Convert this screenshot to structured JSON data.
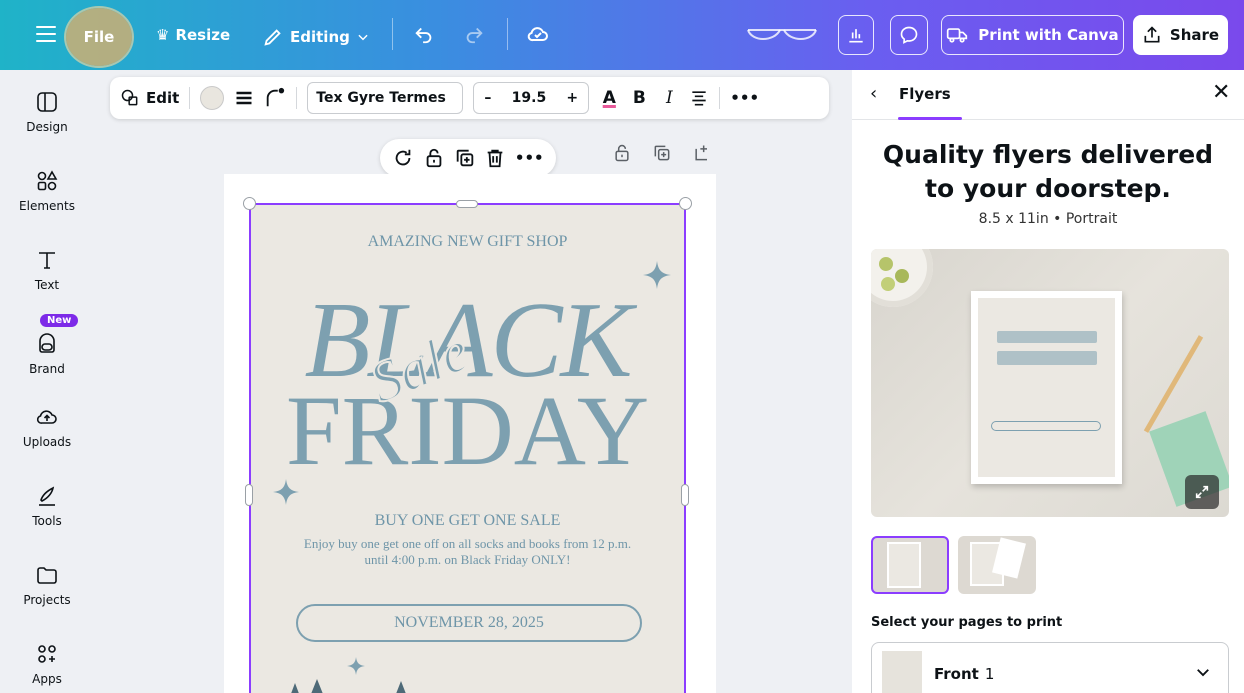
{
  "topbar": {
    "file_label": "File",
    "resize_label": "Resize",
    "editing_label": "Editing",
    "print_label": "Print with Canva",
    "share_label": "Share"
  },
  "sidebar": {
    "items": [
      {
        "label": "Design",
        "icon": "design-icon"
      },
      {
        "label": "Elements",
        "icon": "elements-icon"
      },
      {
        "label": "Text",
        "icon": "text-icon"
      },
      {
        "label": "Brand",
        "icon": "brand-icon"
      },
      {
        "label": "Uploads",
        "icon": "uploads-icon"
      },
      {
        "label": "Tools",
        "icon": "tools-icon"
      },
      {
        "label": "Projects",
        "icon": "projects-icon"
      },
      {
        "label": "Apps",
        "icon": "apps-icon"
      }
    ],
    "new_badge": "New"
  },
  "text_toolbar": {
    "edit_label": "Edit",
    "font": "Tex Gyre Termes",
    "size": "19.5",
    "minus": "–",
    "plus": "+",
    "color_glyph": "A",
    "bold_glyph": "B",
    "italic_glyph": "I",
    "more": "•••"
  },
  "elem_toolbar": {
    "more": "•••"
  },
  "flyer": {
    "shop": "AMAZING NEW GIFT SHOP",
    "black": "BLACK",
    "sale": "Sale",
    "friday": "FRIDAY",
    "bogo": "BUY ONE GET ONE SALE",
    "description": "Enjoy buy one get one off on all socks and books from 12 p.m. until 4:00 p.m. on Black Friday ONLY!",
    "date": "NOVEMBER 28, 2025"
  },
  "panel": {
    "back": "‹",
    "title": "Flyers",
    "close": "✕",
    "headline": "Quality flyers delivered to your doorstep.",
    "subtitle": "8.5 x 11in • Portrait",
    "select_label": "Select your pages to print",
    "page_name": "Front",
    "page_number": "1"
  },
  "colors": {
    "accent": "#8b3dff",
    "flyer_text": "#7da0b0",
    "flyer_bg": "#ebe8e2"
  }
}
